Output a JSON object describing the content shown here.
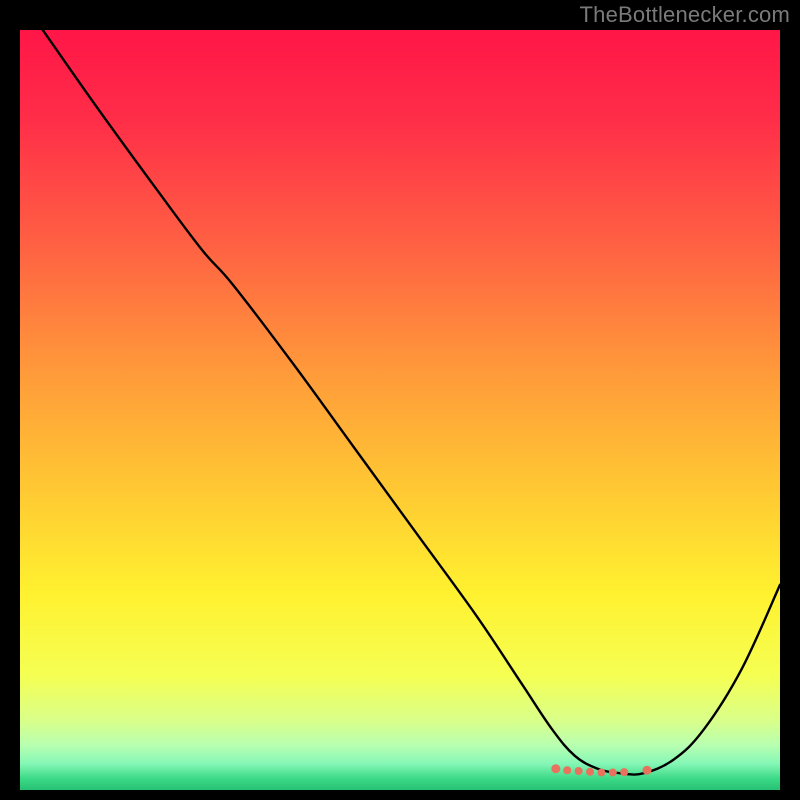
{
  "attribution": "TheBottlenecker.com",
  "chart_data": {
    "type": "line",
    "title": "",
    "xlabel": "",
    "ylabel": "",
    "xlim": [
      0,
      100
    ],
    "ylim": [
      0,
      100
    ],
    "background_gradient_stops": [
      {
        "offset": 0,
        "color": "#ff1647"
      },
      {
        "offset": 12,
        "color": "#ff2e48"
      },
      {
        "offset": 28,
        "color": "#ff6043"
      },
      {
        "offset": 45,
        "color": "#ff9a3a"
      },
      {
        "offset": 60,
        "color": "#ffc733"
      },
      {
        "offset": 74,
        "color": "#fff12f"
      },
      {
        "offset": 85,
        "color": "#f5ff53"
      },
      {
        "offset": 91,
        "color": "#d8ff8b"
      },
      {
        "offset": 94,
        "color": "#b9ffb0"
      },
      {
        "offset": 96.5,
        "color": "#86f7b6"
      },
      {
        "offset": 98.5,
        "color": "#3cd987"
      },
      {
        "offset": 100,
        "color": "#26c173"
      }
    ],
    "series": [
      {
        "name": "bottleneck-curve",
        "color": "#000000",
        "x": [
          3,
          10,
          18,
          24,
          28,
          36,
          44,
          52,
          60,
          66,
          70,
          73,
          76,
          79,
          82,
          86,
          90,
          95,
          100
        ],
        "y": [
          100,
          90,
          79,
          71,
          66.5,
          56,
          45,
          34,
          23,
          14,
          8,
          4.5,
          2.8,
          2.2,
          2.2,
          4,
          8,
          16,
          27
        ]
      }
    ],
    "markers": {
      "name": "optimal-zone-markers",
      "color": "#e8725e",
      "points": [
        {
          "x": 70.5,
          "y": 2.8,
          "r": 4.5
        },
        {
          "x": 72.0,
          "y": 2.6,
          "r": 4.0
        },
        {
          "x": 73.5,
          "y": 2.5,
          "r": 4.0
        },
        {
          "x": 75.0,
          "y": 2.4,
          "r": 4.0
        },
        {
          "x": 76.5,
          "y": 2.3,
          "r": 4.0
        },
        {
          "x": 78.0,
          "y": 2.3,
          "r": 4.0
        },
        {
          "x": 79.5,
          "y": 2.35,
          "r": 4.0
        },
        {
          "x": 82.5,
          "y": 2.6,
          "r": 4.5
        }
      ]
    }
  }
}
